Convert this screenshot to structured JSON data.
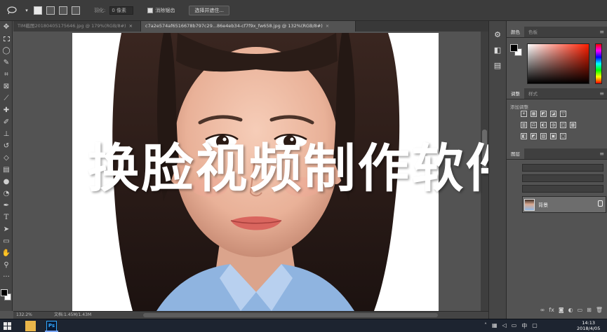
{
  "options_bar": {
    "feather_label": "羽化:",
    "feather_value": "0 像素",
    "antialias_label": "消除锯齿",
    "select_mask_button": "选择并遮住..."
  },
  "tabs": [
    {
      "label": "TIM截图20180405175646.jpg @ 179%(RGB/8#)",
      "active": false
    },
    {
      "label": "c7a2e574af6516678b797c29...86e4eb34-cf7f9x_fw658.jpg @ 132%(RGB/8#)",
      "active": true
    }
  ],
  "caption": "换脸视频制作软件",
  "status": {
    "zoom": "132.2%",
    "doc": "文档:1.45M/1.43M"
  },
  "panels": {
    "color_tabs": [
      "颜色",
      "色板"
    ],
    "adjust_tabs": [
      "调整",
      "样式"
    ],
    "adjust_title": "添加调整",
    "adjust_row1": [
      "☀",
      "▦",
      "◩",
      "◪",
      "▽"
    ],
    "adjust_row2": [
      "▥",
      "⚖",
      "◐",
      "◍",
      "◰",
      "▩"
    ],
    "adjust_row3": [
      "◧",
      "◩",
      "▨",
      "▣",
      "▢"
    ],
    "layers_tab": "图层",
    "layer_name": "背景"
  },
  "taskbar": {
    "time": "14:13",
    "date": "2018/4/05"
  },
  "colors": {
    "ps_dark": "#535353",
    "ps_panel": "#3c3c3c",
    "taskbar": "#1d2430",
    "ps_blue": "#31a8ff"
  }
}
